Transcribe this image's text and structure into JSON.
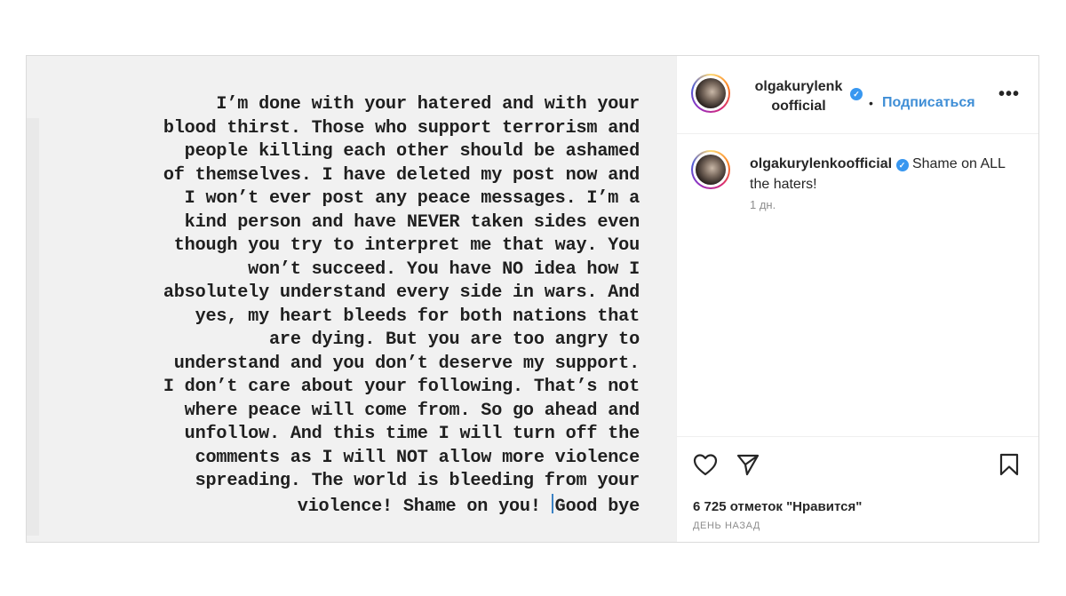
{
  "post": {
    "text_lines": [
      "I’m done with your hatered and with your",
      "blood thirst. Those who support terrorism and",
      "people killing each other should be ashamed",
      "of themselves. I have deleted my post now and",
      "I won’t ever post any peace messages. I’m a",
      "kind person and have NEVER taken sides even",
      "though you try to interpret me that way. You",
      "won’t succeed. You have NO idea how I",
      "absolutely understand every side in wars. And",
      "yes, my heart bleeds for both nations that",
      "are dying. But you are too angry to",
      "understand and you don’t deserve my support.",
      "I don’t care about your following. That’s not",
      "where peace will come from. So go ahead and",
      "unfollow. And this time I will turn off the",
      "comments as I will NOT allow more violence",
      "spreading. The world is bleeding from your"
    ],
    "last_line_before_cursor": "violence! Shame on you! ",
    "last_line_after_cursor": "Good bye"
  },
  "header": {
    "username_line1": "olgakurylenk",
    "username_line2": "oofficial",
    "verified_icon": "verified-badge-icon",
    "dot": "•",
    "follow_label": "Подписаться",
    "more_label": "•••"
  },
  "comment": {
    "username": "olgakurylenkoofficial",
    "text": " Shame on ALL the haters!",
    "time": "1 дн."
  },
  "actions": {
    "icons": [
      "heart-icon",
      "share-icon",
      "bookmark-icon"
    ],
    "likes": "6 725 отметок \"Нравится\"",
    "time_ago": "ДЕНЬ НАЗАД"
  },
  "colors": {
    "follow": "#3f8ed6",
    "verified": "#3897f0",
    "border": "#dbdbdb"
  }
}
